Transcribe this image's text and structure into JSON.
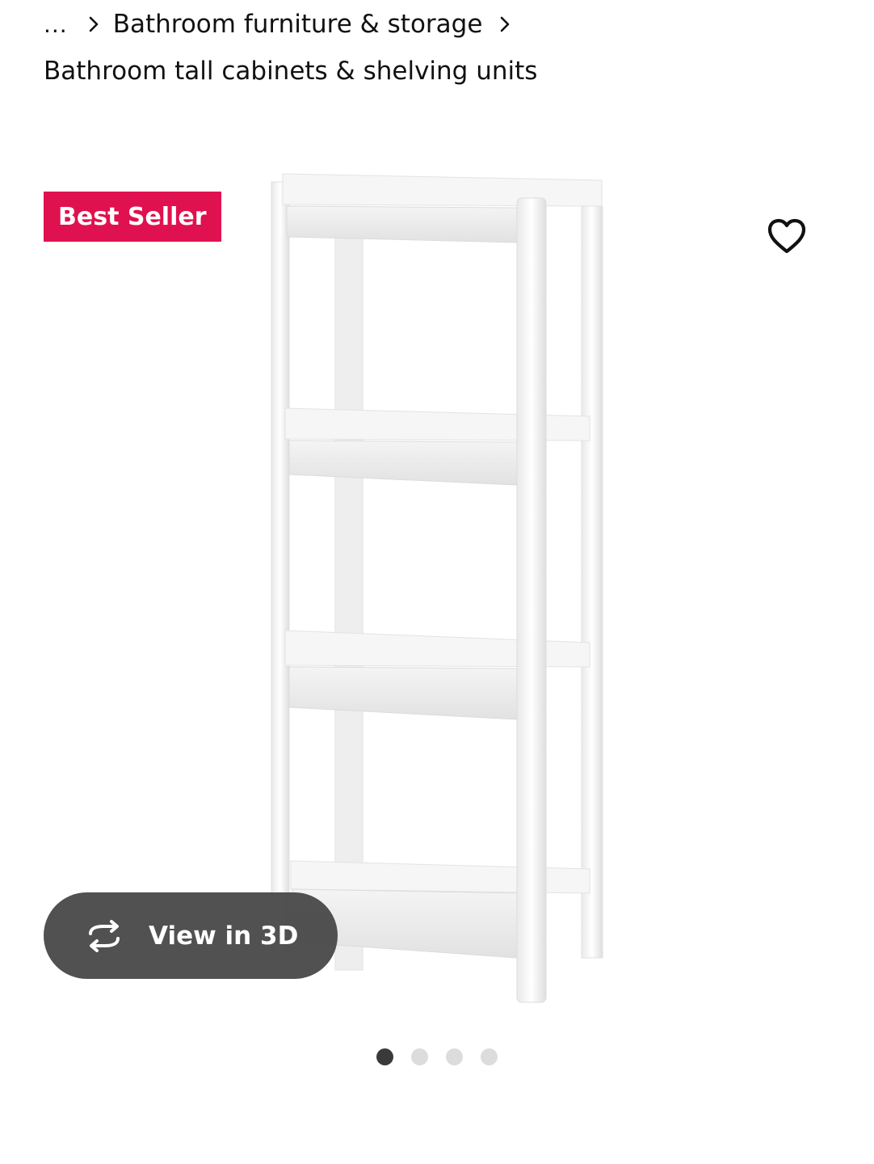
{
  "breadcrumb": {
    "ellipsis": "...",
    "parent": "Bathroom furniture & storage",
    "current": "Bathroom tall cabinets & shelving units"
  },
  "product": {
    "badge": "Best Seller",
    "view_3d_label": "View in 3D",
    "image_count": 4,
    "active_image_index": 0
  },
  "icons": {
    "breadcrumb_separator": "chevron-right-icon",
    "favorite": "heart-outline-icon",
    "view_3d": "rotate-3d-icon"
  },
  "colors": {
    "badge_bg": "#e0114f",
    "button_bg": "#484848",
    "dot_active": "#3a3a3a",
    "dot_inactive": "#dcdcdc"
  }
}
